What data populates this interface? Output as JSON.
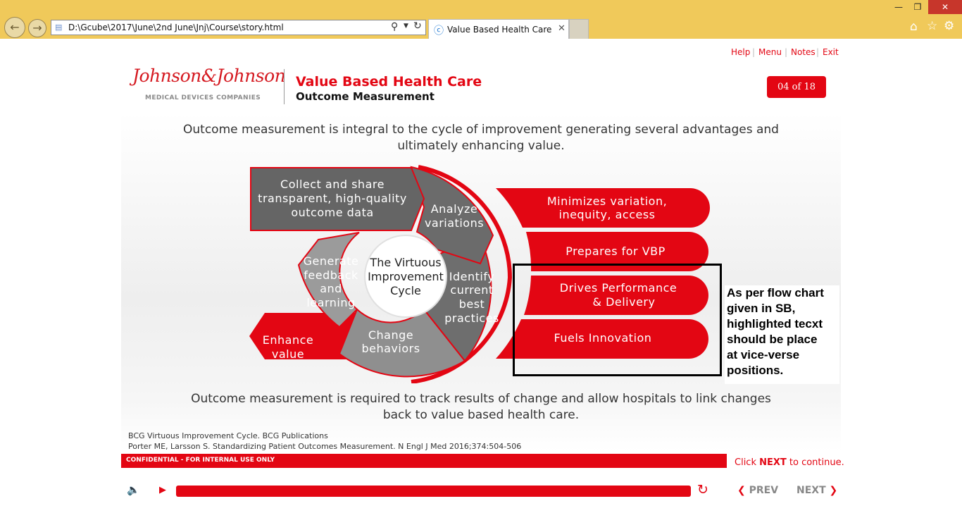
{
  "browser": {
    "address": "D:\\Gcube\\2017\\June\\2nd June\\Jnj\\Course\\story.html",
    "tab_title": "Value Based Health Care"
  },
  "top_nav": [
    "Help",
    "Menu",
    "Notes",
    "Exit"
  ],
  "header": {
    "logo_text": "Johnson&Johnson",
    "logo_sub": "MEDICAL DEVICES COMPANIES",
    "title": "Value Based Health Care",
    "subtitle": "Outcome Measurement",
    "page_indicator": "04 of 18"
  },
  "intro_lines": [
    "Outcome measurement is integral to the cycle of improvement generating several advantages and",
    "ultimately enhancing value."
  ],
  "cycle": {
    "center": [
      "The Virtuous",
      "Improvement",
      "Cycle"
    ],
    "collect": [
      "Collect and share",
      "transparent, high-quality",
      "outcome data"
    ],
    "analyze": [
      "Analyze",
      "variations"
    ],
    "identify": [
      "Identify",
      "current",
      "best",
      "practices"
    ],
    "change": [
      "Change",
      "behaviors"
    ],
    "generate": [
      "Generate",
      "feedback",
      "and",
      "learning"
    ],
    "enhance": [
      "Enhance",
      "value"
    ]
  },
  "benefits": [
    [
      "Minimizes variation,",
      "inequity, access"
    ],
    [
      "Prepares for VBP"
    ],
    [
      "Drives Performance",
      "& Delivery"
    ],
    [
      "Fuels Innovation"
    ]
  ],
  "note": [
    "As per flow chart",
    "given in SB,",
    "highlighted tecxt",
    "should be place",
    "at vice-verse",
    "positions."
  ],
  "outro_lines": [
    "Outcome measurement is required to track results of change and allow hospitals to link changes",
    "back to value based health care."
  ],
  "references": [
    "BCG Virtuous Improvement Cycle. BCG Publications",
    "Porter ME, Larsson S. Standardizing Patient Outcomes Measurement. N Engl J Med 2016;374:504-506"
  ],
  "confidential": "CONFIDENTIAL - FOR INTERNAL USE ONLY",
  "continue": {
    "pre": "Click ",
    "key": "NEXT",
    "post": " to continue."
  },
  "player": {
    "prev": "PREV",
    "next": "NEXT",
    "progress": 1.0
  },
  "colors": {
    "brand_red": "#e30613",
    "dark_gray": "#656565",
    "mid_gray": "#8f8f8f",
    "chrome": "#f0c95a"
  },
  "icons": [
    "back-arrow-icon",
    "forward-arrow-icon",
    "search-icon",
    "refresh-icon",
    "ie-icon",
    "home-icon",
    "star-icon",
    "gear-icon",
    "speaker-icon",
    "play-icon",
    "replay-icon"
  ]
}
